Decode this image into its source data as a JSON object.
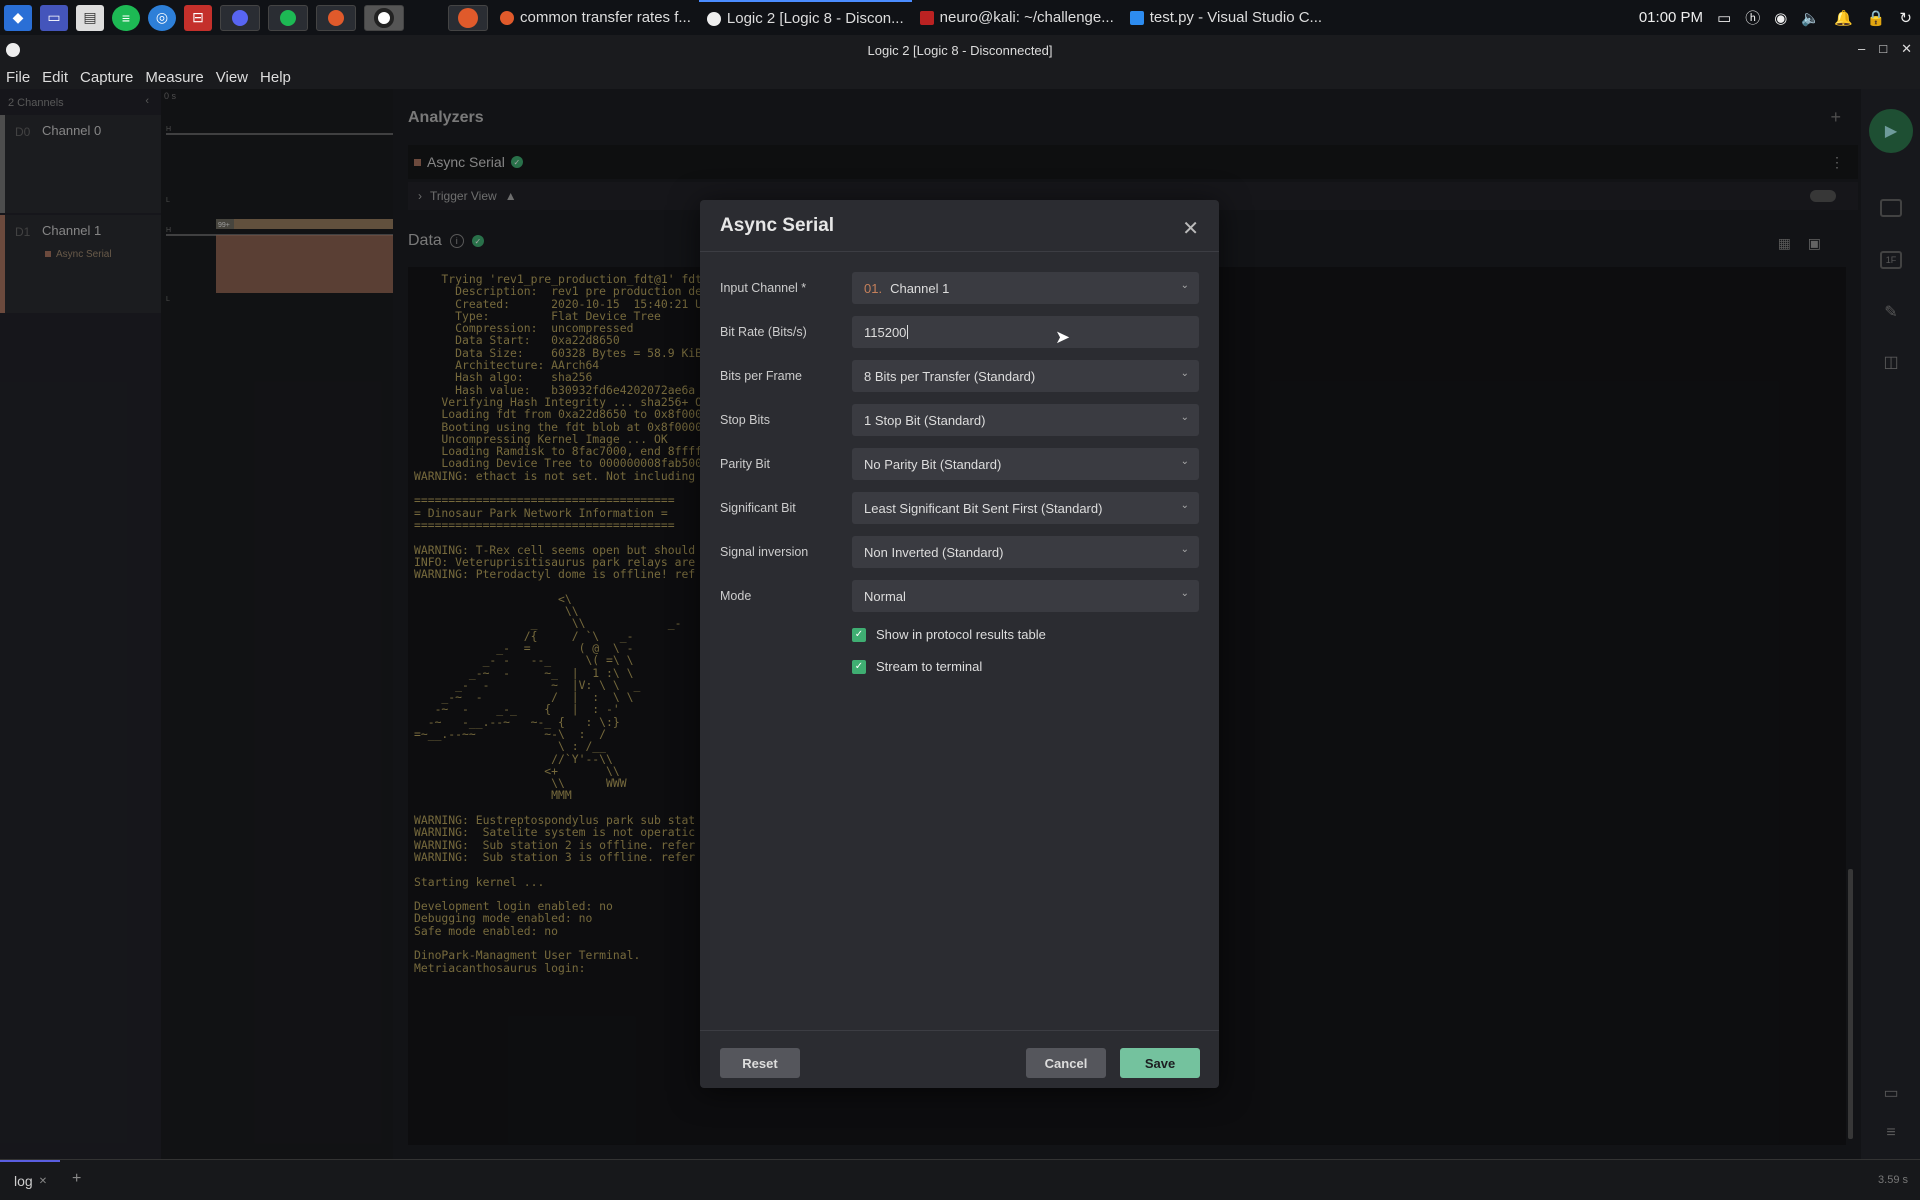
{
  "taskbar": {
    "tabs": [
      {
        "label": "common transfer rates f..."
      },
      {
        "label": "Logic 2 [Logic 8 - Discon..."
      },
      {
        "label": "neuro@kali: ~/challenge..."
      },
      {
        "label": "test.py - Visual Studio C..."
      }
    ],
    "clock": "01:00 PM",
    "colors": {
      "active_tab_border": "#4a8cff"
    }
  },
  "window": {
    "title": "Logic 2 [Logic 8 - Disconnected]"
  },
  "menu": [
    "File",
    "Edit",
    "Capture",
    "Measure",
    "View",
    "Help"
  ],
  "channels": {
    "header": "2 Channels",
    "items": [
      {
        "num": "D0",
        "name": "Channel 0",
        "sub": ""
      },
      {
        "num": "D1",
        "name": "Channel 1",
        "sub": "Async Serial"
      }
    ],
    "wave_ruler": "0 s",
    "badge": "99+"
  },
  "analyzers": {
    "title": "Analyzers",
    "analyzer_name": "Async Serial",
    "trigger_label": "Trigger View"
  },
  "data": {
    "title": "Data",
    "terminal": "    Trying 'rev1_pre_production_fdt@1' fdt\n      Description:  rev1 pre production de\n      Created:      2020-10-15  15:40:21 U\n      Type:         Flat Device Tree\n      Compression:  uncompressed\n      Data Start:   0xa22d8650\n      Data Size:    60328 Bytes = 58.9 KiB\n      Architecture: AArch64\n      Hash algo:    sha256\n      Hash value:   b30932fd6e4202072ae6a\n    Verifying Hash Integrity ... sha256+ O\n    Loading fdt from 0xa22d8650 to 0x8f000\n    Booting using the fdt blob at 0x8f0000\n    Uncompressing Kernel Image ... OK\n    Loading Ramdisk to 8fac7000, end 8ffff\n    Loading Device Tree to 000000008fab500\nWARNING: ethact is not set. Not including\n\n======================================\n= Dinosaur Park Network Information =\n======================================\n\nWARNING: T-Rex cell seems open but should\nINFO: Veteruprisitisaurus park relays are\nWARNING: Pterodactyl dome is offline! ref\n\n                     <\\\n                      \\\\\n                 _     \\\\            _-\n                /{     / `\\   _-\n            _-  =       ( @  \\ -\n          _- -   --_     \\( =\\ \\\n        _-~  -     ~_  |  1 :\\ \\\n      _-  -         ~  |V: \\ \\  _\n    _-~  -          /  |  :  \\ \\\n   -~  -    _-_    {   |  : -'\n  -~   -__.--~   ~-_ {   : \\:}\n=~__.--~~          ~-\\  :  /\n                     \\ : /__\n                    //`Y'--\\\\\n                   <+       \\\\\n                    \\\\      WWW\n                    MMM\n\nWARNING: Eustreptospondylus park sub stat\nWARNING:  Satelite system is not operatic\nWARNING:  Sub station 2 is offline. refer\nWARNING:  Sub station 3 is offline. refer\n\nStarting kernel ...\n\nDevelopment login enabled: no\nDebugging mode enabled: no\nSafe mode enabled: no\n\nDinoPark-Managment User Terminal.\nMetriacanthosaurus login:"
  },
  "dialog": {
    "title": "Async Serial",
    "fields": [
      {
        "label": "Input Channel *",
        "prefix": "01.",
        "value": "Channel 1"
      },
      {
        "label": "Bit Rate (Bits/s)",
        "value": "115200"
      },
      {
        "label": "Bits per Frame",
        "value": "8 Bits per Transfer (Standard)"
      },
      {
        "label": "Stop Bits",
        "value": "1 Stop Bit (Standard)"
      },
      {
        "label": "Parity Bit",
        "value": "No Parity Bit (Standard)"
      },
      {
        "label": "Significant Bit",
        "value": "Least Significant Bit Sent First (Standard)"
      },
      {
        "label": "Signal inversion",
        "value": "Non Inverted (Standard)"
      },
      {
        "label": "Mode",
        "value": "Normal"
      }
    ],
    "checkboxes": [
      {
        "label": "Show in protocol results table",
        "checked": true
      },
      {
        "label": "Stream to terminal",
        "checked": true
      }
    ],
    "buttons": {
      "reset": "Reset",
      "cancel": "Cancel",
      "save": "Save"
    },
    "colors": {
      "save": "#74c29e",
      "check": "#3fae72"
    }
  },
  "bottom": {
    "tab": "log",
    "time": "3.59 s"
  }
}
